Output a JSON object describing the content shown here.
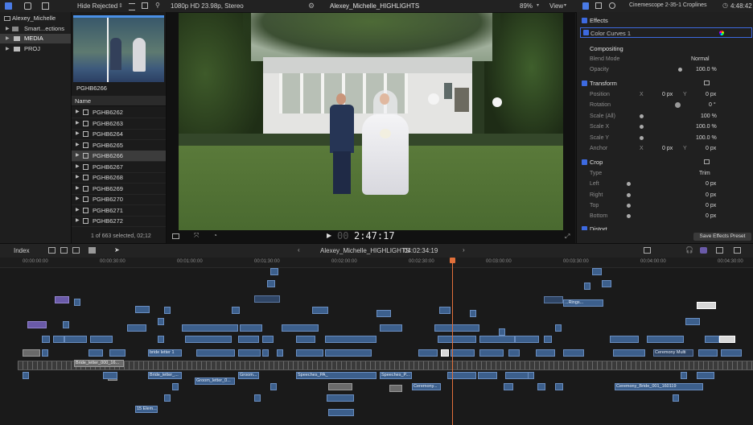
{
  "topbar": {
    "filter": "Hide Rejected",
    "format": "1080p HD 23.98p, Stereo",
    "project_title": "Alexey_Michelle_HIGHLIGHTS",
    "zoom": "89%",
    "view": "View",
    "effect_name": "Cinemescope 2-35-1 Croplines",
    "duration": "4:48:42"
  },
  "library": {
    "items": [
      {
        "label": "Alexey_Michelle",
        "selected": false
      },
      {
        "label": "Smart...ections",
        "selected": false
      },
      {
        "label": "MEDIA",
        "selected": true
      },
      {
        "label": "PROJ",
        "selected": false
      }
    ]
  },
  "browser": {
    "thumb_label": "PGHB6266",
    "column_header": "Name",
    "clips": [
      {
        "label": "PGHB6262",
        "selected": false
      },
      {
        "label": "PGHB6263",
        "selected": false
      },
      {
        "label": "PGHB6264",
        "selected": false
      },
      {
        "label": "PGHB6265",
        "selected": false
      },
      {
        "label": "PGHB6266",
        "selected": true
      },
      {
        "label": "PGHB6267",
        "selected": false
      },
      {
        "label": "PGHB6268",
        "selected": false
      },
      {
        "label": "PGHB6269",
        "selected": false
      },
      {
        "label": "PGHB6270",
        "selected": false
      },
      {
        "label": "PGHB6271",
        "selected": false
      },
      {
        "label": "PGHB6272",
        "selected": false
      }
    ],
    "status": "1 of 663 selected, 02;12"
  },
  "viewer": {
    "timecode_dim": "00",
    "timecode": "2:47:17"
  },
  "inspector": {
    "effects": "Effects",
    "color_curves": "Color Curves 1",
    "compositing": "Compositing",
    "blend_mode_label": "Blend Mode",
    "blend_mode_value": "Normal",
    "opacity_label": "Opacity",
    "opacity_value": "100.0 %",
    "transform": "Transform",
    "position_label": "Position",
    "position_x_lbl": "X",
    "position_x": "0 px",
    "position_y_lbl": "Y",
    "position_y": "0 px",
    "rotation_label": "Rotation",
    "rotation_value": "0 °",
    "scale_all_label": "Scale (All)",
    "scale_all_value": "100 %",
    "scale_x_label": "Scale X",
    "scale_x_value": "100.0 %",
    "scale_y_label": "Scale Y",
    "scale_y_value": "100.0 %",
    "anchor_label": "Anchor",
    "anchor_x_lbl": "X",
    "anchor_x": "0 px",
    "anchor_y_lbl": "Y",
    "anchor_y": "0 px",
    "crop": "Crop",
    "type_label": "Type",
    "type_value": "Trim",
    "left_label": "Left",
    "left_value": "0 px",
    "right_label": "Right",
    "right_value": "0 px",
    "top_label": "Top",
    "top_value": "0 px",
    "bottom_label": "Bottom",
    "bottom_value": "0 px",
    "distort": "Distort",
    "save_preset": "Save Effects Preset"
  },
  "timeline": {
    "index": "Index",
    "project": "Alexey_Michelle_HIGHLIGHTS",
    "duration": "04:02:34:19",
    "ruler": [
      "00:00:00:00",
      "00:00:30:00",
      "00:01:00:00",
      "00:01:30:00",
      "00:02:00:00",
      "00:02:30:00",
      "00:03:00:00",
      "00:03:30:00",
      "00:04:00:00",
      "00:04:30:00"
    ],
    "clip_labels": {
      "bride_letter": "Bride_letter_000_16...",
      "bride_letter_1": "bride letter 1",
      "groom_letter": "Groom_letter_0...",
      "groom": "Groom...",
      "speeches_pa": "Speeches_PA_",
      "speeches_p": "Speeches_P...",
      "ceremony": "Ceremony...",
      "ceremony_bride": "Ceremony_Bride_001_160119",
      "ceremony_multi": "Ceremony Multi",
      "fifteen_elem": "15 Elem...",
      "bride_short": "Bride_letter_...",
      "rings": "...Rings..."
    }
  },
  "colors": {
    "accent_blue": "#3d6ae0",
    "playhead": "#e2703a",
    "clip_blue": "#3c5f8c"
  }
}
